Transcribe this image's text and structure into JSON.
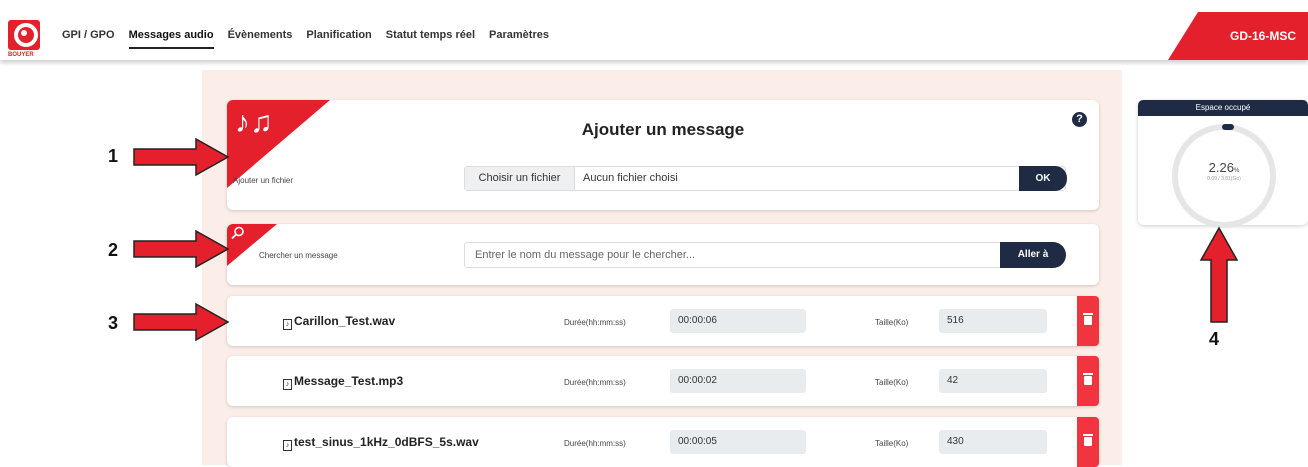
{
  "header": {
    "logo_text": "BOUYER",
    "nav": [
      {
        "label": "GPI / GPO"
      },
      {
        "label": "Messages audio",
        "active": true
      },
      {
        "label": "Évènements"
      },
      {
        "label": "Planification"
      },
      {
        "label": "Statut temps réel"
      },
      {
        "label": "Paramètres"
      }
    ],
    "device": "GD-16-MSC"
  },
  "add": {
    "title": "Ajouter un message",
    "file_label": "Ajouter un fichier",
    "choose_btn": "Choisir un fichier",
    "no_file": "Aucun fichier choisi",
    "ok": "OK",
    "help": "?"
  },
  "search": {
    "label": "Chercher un message",
    "placeholder": "Entrer le nom du message pour le chercher...",
    "go": "Aller à"
  },
  "messages": {
    "duration_label": "Durée(hh:mm:ss)",
    "size_label": "Taille(Ko)",
    "rows": [
      {
        "name": "Carillon_Test.wav",
        "duration": "00:00:06",
        "size": "516"
      },
      {
        "name": "Message_Test.mp3",
        "duration": "00:00:02",
        "size": "42"
      },
      {
        "name": "test_sinus_1kHz_0dBFS_5s.wav",
        "duration": "00:00:05",
        "size": "430"
      }
    ]
  },
  "space": {
    "title": "Espace occupé",
    "percent": "2.26",
    "unit": "%",
    "detail": "0.09 / 3.81(Go)"
  },
  "annotations": [
    "1",
    "2",
    "3",
    "4"
  ],
  "colors": {
    "accent": "#e4202c",
    "dark": "#1f2a44",
    "panel": "#fbeee8",
    "delete": "#f03540"
  }
}
